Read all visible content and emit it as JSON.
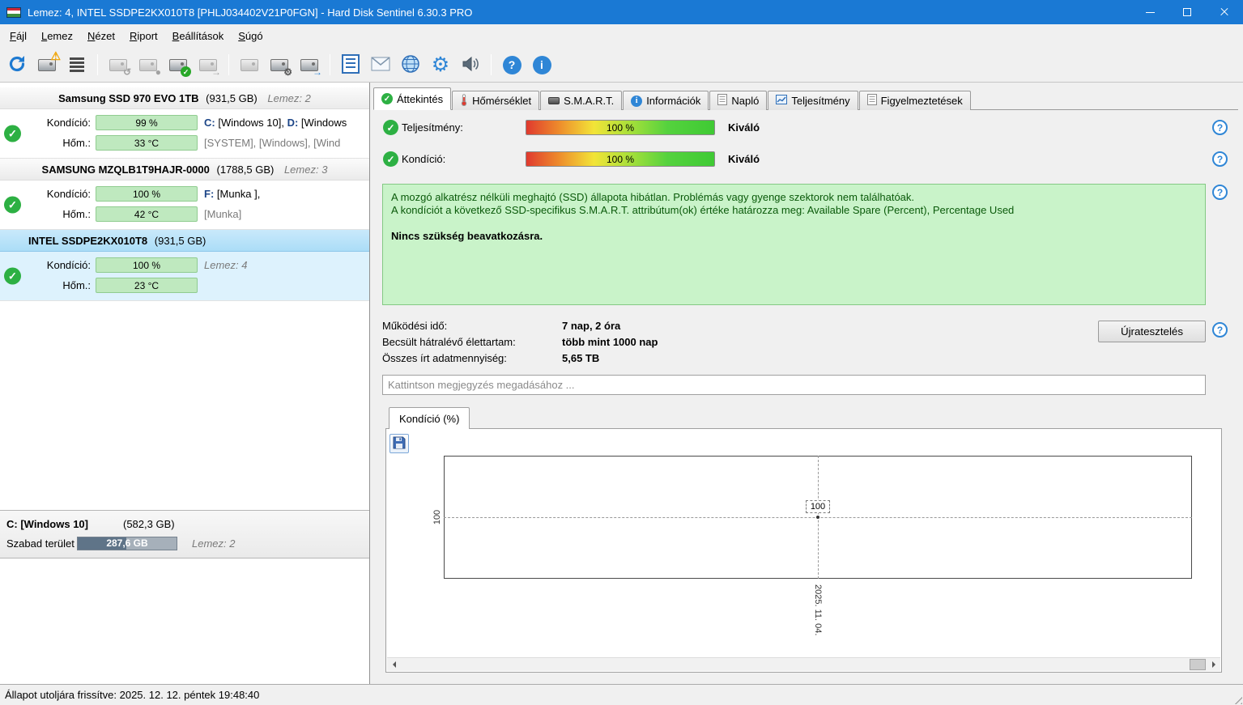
{
  "window": {
    "title": "Lemez: 4, INTEL SSDPE2KX010T8 [PHLJ034402V21P0FGN]  -  Hard Disk Sentinel 6.30.3 PRO"
  },
  "menu": {
    "items": [
      "Fájl",
      "Lemez",
      "Nézet",
      "Riport",
      "Beállítások",
      "Súgó"
    ]
  },
  "icons": {
    "check": "✓",
    "warning": "⚠",
    "undo": "↺",
    "stop": "●",
    "arrow": "→",
    "gear": "⚙",
    "help": "?",
    "info": "i"
  },
  "sidebar": {
    "disks": [
      {
        "name": "Samsung SSD 970 EVO 1TB",
        "size": "(931,5 GB)",
        "disk_label": "Lemez: 2",
        "condition_label": "Kondíció:",
        "condition_value": "99 %",
        "temp_label": "Hőm.:",
        "temp_value": "33 °C",
        "part1_drive": "C:",
        "part1_name": " [Windows 10], ",
        "part2_drive": "D:",
        "part2_name": " [Windows",
        "partitions2": "[SYSTEM],  [Windows],  [Wind"
      },
      {
        "name": "SAMSUNG MZQLB1T9HAJR-0000",
        "size": "(1788,5 GB)",
        "disk_label": "Lemez: 3",
        "condition_label": "Kondíció:",
        "condition_value": "100 %",
        "temp_label": "Hőm.:",
        "temp_value": "42 °C",
        "part1_drive": "F:",
        "part1_name": " [Munka ],",
        "partitions2": "[Munka]"
      },
      {
        "name": "INTEL SSDPE2KX010T8",
        "size": "(931,5 GB)",
        "disk_label": "Lemez: 4",
        "condition_label": "Kondíció:",
        "condition_value": "100 %",
        "temp_label": "Hőm.:",
        "temp_value": "23 °C"
      }
    ],
    "volume": {
      "name": "C: [Windows 10]",
      "size": "(582,3 GB)",
      "free_label": "Szabad terület",
      "free_value": "287,6 GB",
      "disk_label": "Lemez: 2"
    }
  },
  "tabs": [
    {
      "label": "Áttekintés"
    },
    {
      "label": "Hőmérséklet"
    },
    {
      "label": "S.M.A.R.T."
    },
    {
      "label": "Információk"
    },
    {
      "label": "Napló"
    },
    {
      "label": "Teljesítmény"
    },
    {
      "label": "Figyelmeztetések"
    }
  ],
  "overview": {
    "performance_label": "Teljesítmény:",
    "performance_value": "100 %",
    "performance_rating": "Kiváló",
    "condition_label": "Kondíció:",
    "condition_value": "100 %",
    "condition_rating": "Kiváló",
    "status_line1": "A mozgó alkatrész nélküli meghajtó (SSD) állapota hibátlan. Problémás vagy gyenge szektorok nem találhatóak.",
    "status_line2": "A kondíciót a következő SSD-specifikus S.M.A.R.T. attribútum(ok) értéke határozza meg:  Available Spare (Percent), Percentage Used",
    "status_action": "Nincs szükség beavatkozásra.",
    "info_rows": [
      {
        "label": "Működési idő:",
        "value": "7 nap, 2 óra"
      },
      {
        "label": "Becsült hátralévő élettartam:",
        "value": "több mint 1000 nap"
      },
      {
        "label": "Összes írt adatmennyiség:",
        "value": "5,65 TB"
      }
    ],
    "retest_button": "Újratesztelés",
    "comment_placeholder": "Kattintson megjegyzés megadásához ..."
  },
  "chart_data": {
    "type": "line",
    "title": "Kondíció  (%)",
    "x": [
      "2025. 11. 04."
    ],
    "series": [
      {
        "name": "Kondíció",
        "values": [
          100
        ]
      }
    ],
    "ylim": [
      0,
      100
    ],
    "y_tick": "100",
    "point_label": "100",
    "x_tick": "2025. 11. 04.",
    "grid": "dashed"
  },
  "statusbar": {
    "text": "Állapot utoljára frissítve: 2025. 12. 12. péntek 19:48:40"
  }
}
